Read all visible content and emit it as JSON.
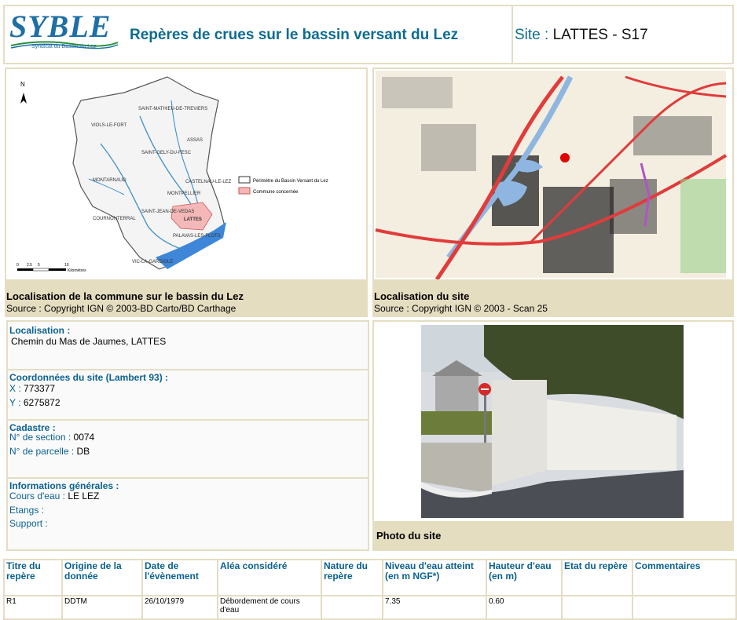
{
  "header": {
    "logo_text": "SYBLE",
    "logo_subtitle": "Syndicat du Bassin du Lez",
    "title": "Repères de crues sur le bassin versant du Lez",
    "site_prefix": "Site :",
    "site_value": "LATTES - S17"
  },
  "map1": {
    "towns": [
      "SAINT-MATHIEU-DE-TREVIERS",
      "VIOLS-LE-FORT",
      "ASSAS",
      "SAINT-GELY-DU-FESC",
      "MONTARNAUD",
      "CASTELNAU-LE-LEZ",
      "MONTPELLIER",
      "SAINT-JEAN-DE-VEDAS",
      "LATTES",
      "COURNONTERRAL",
      "PALAVAS-LES-FLOTS",
      "VIC-LA-GARDIOLE"
    ],
    "legend": [
      "Périmètre du Bassin Versant du Lez",
      "Commune concernée"
    ],
    "scale_ticks": [
      "0",
      "2.5",
      "5",
      "10"
    ],
    "scale_unit": "Kilomètres",
    "north": "N",
    "caption_title": "Localisation de la commune sur le bassin du Lez",
    "caption_source": "Source : Copyright IGN © 2003-BD Carto/BD Carthage"
  },
  "map2": {
    "caption_title": "Localisation du site",
    "caption_source": "Source : Copyright IGN © 2003 - Scan 25"
  },
  "info": {
    "localisation": {
      "title": "Localisation :",
      "value": "Chemin du Mas de Jaumes, LATTES"
    },
    "coords": {
      "title": "Coordonnées du site (Lambert 93) :",
      "x_label": "X :",
      "x": "773377",
      "y_label": "Y :",
      "y": "6275872"
    },
    "cadastre": {
      "title": "Cadastre :",
      "section_label": "N° de section :",
      "section": "0074",
      "parcelle_label": "N° de parcelle :",
      "parcelle": "DB"
    },
    "general": {
      "title": "Informations générales :",
      "cours_label": "Cours d'eau :",
      "cours": "LE LEZ",
      "etangs_label": "Etangs :",
      "support_label": "Support :"
    }
  },
  "photo": {
    "caption": "Photo du site"
  },
  "table": {
    "headers": [
      "Titre du repère",
      "Origine de la donnée",
      "Date de l'évènement",
      "Aléa considéré",
      "Nature du repère",
      "Niveau d'eau atteint (en m NGF*)",
      "Hauteur d'eau (en m)",
      "Etat du repère",
      "Commentaires"
    ],
    "rows": [
      [
        "R1",
        "DDTM",
        "26/10/1979",
        "Débordement de cours d'eau",
        "",
        "7.35",
        "0.60",
        "",
        ""
      ]
    ]
  },
  "colors": {
    "accent": "#0a6190",
    "border": "#e4ddc4",
    "caption_bg": "#e5ddc0"
  }
}
